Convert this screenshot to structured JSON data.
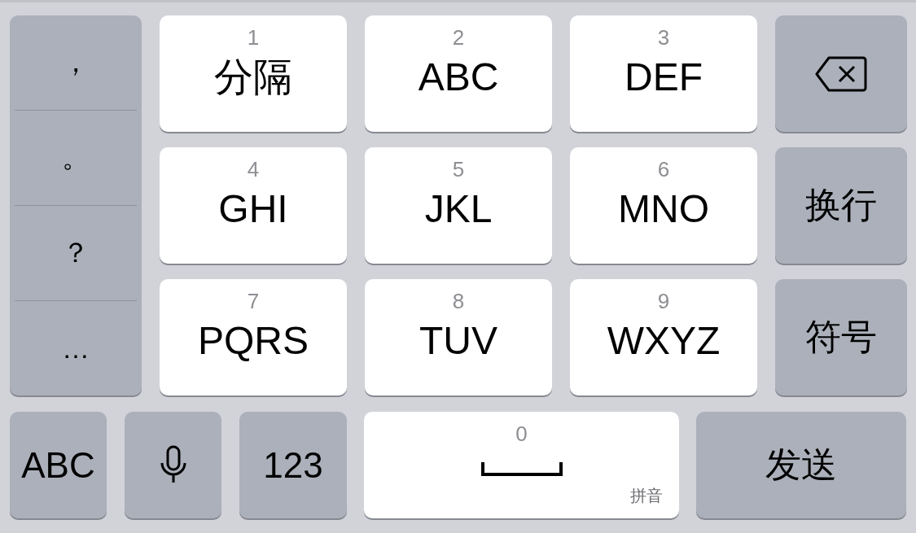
{
  "punctuation": [
    "，",
    "。",
    "？",
    "…"
  ],
  "keys": [
    {
      "digit": "1",
      "label": "分隔"
    },
    {
      "digit": "2",
      "label": "ABC"
    },
    {
      "digit": "3",
      "label": "DEF"
    },
    {
      "digit": "4",
      "label": "GHI"
    },
    {
      "digit": "5",
      "label": "JKL"
    },
    {
      "digit": "6",
      "label": "MNO"
    },
    {
      "digit": "7",
      "label": "PQRS"
    },
    {
      "digit": "8",
      "label": "TUV"
    },
    {
      "digit": "9",
      "label": "WXYZ"
    }
  ],
  "side_keys": [
    {
      "kind": "delete"
    },
    {
      "kind": "text",
      "label": "换行"
    },
    {
      "kind": "text",
      "label": "符号"
    }
  ],
  "bottom_row": [
    {
      "kind": "text",
      "label": "ABC"
    },
    {
      "kind": "mic"
    },
    {
      "kind": "text",
      "label": "123"
    },
    {
      "kind": "space",
      "digit": "0",
      "hint": "拼音"
    },
    {
      "kind": "text",
      "label": "发送"
    }
  ]
}
